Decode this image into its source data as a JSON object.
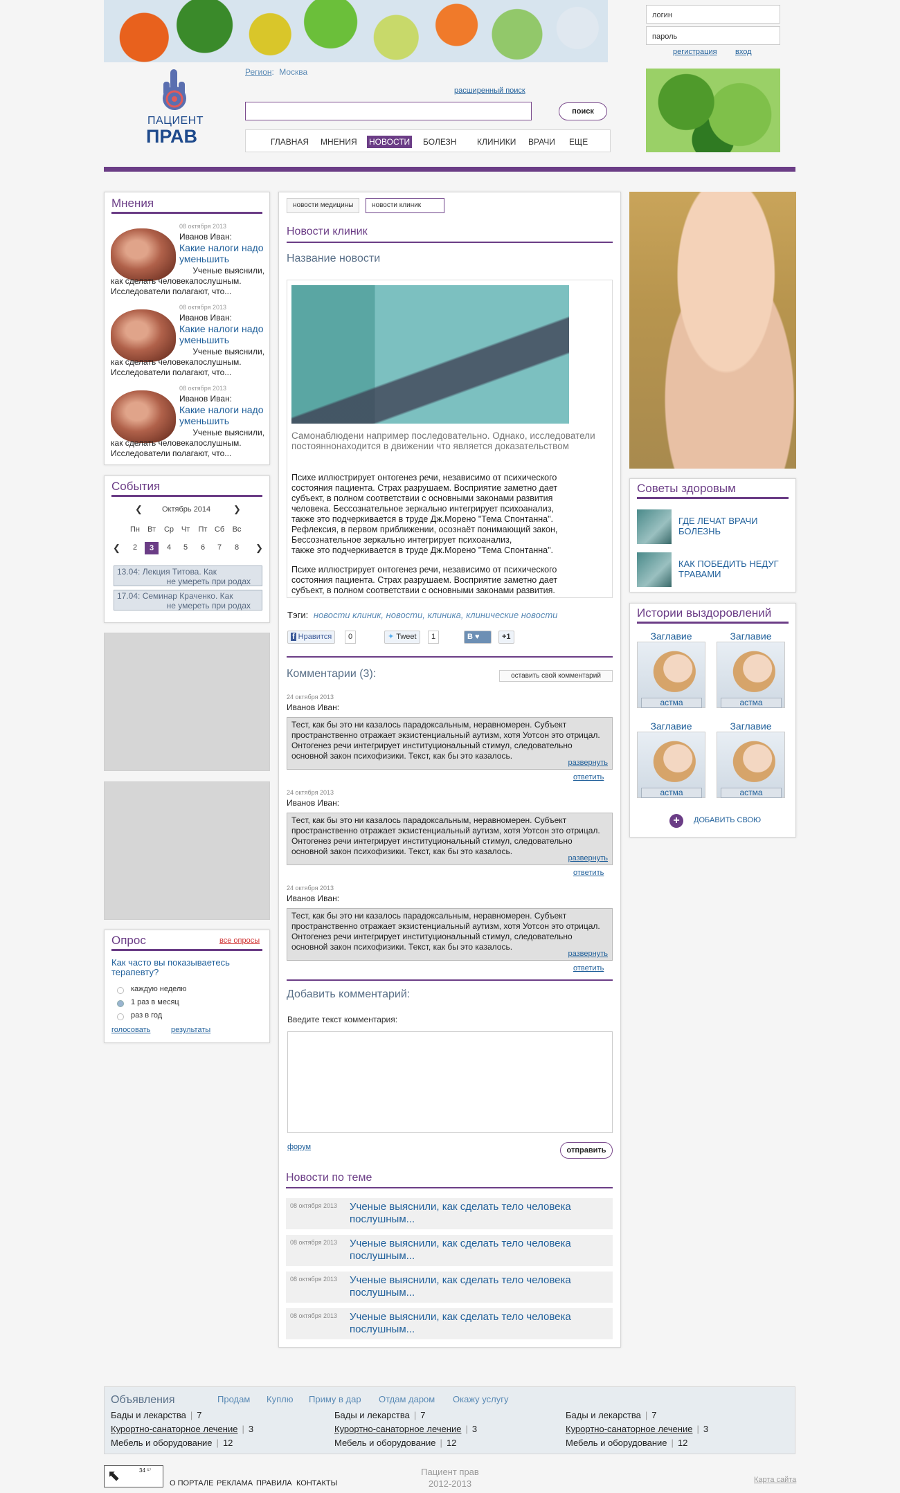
{
  "header": {
    "login_placeholder": "логин",
    "password_placeholder": "пароль",
    "register": "регистрация",
    "login": "вход",
    "logo_line1": "ПАЦИЕНТ",
    "logo_line2": "ПРАВ",
    "region_label": "Регион",
    "region_value": "Москва",
    "advanced_search": "расширенный поиск",
    "search_button": "поиск",
    "nav": [
      "главная",
      "мнения",
      "новости",
      "болезн",
      "клиники",
      "врачи",
      "еще"
    ],
    "nav_active_index": 2
  },
  "opinions": {
    "title": "Мнения",
    "items": [
      {
        "date": "08 октября 2013",
        "author": "Иванов Иван:",
        "title": "Какие налоги надо уменьшить",
        "text1": "Ученые выяснили,",
        "text2": "как сделать человекапослушным. Исследователи полагают, что..."
      },
      {
        "date": "08 октября 2013",
        "author": "Иванов Иван:",
        "title": "Какие налоги надо уменьшить",
        "text1": "Ученые выяснили,",
        "text2": "как сделать человекапослушным. Исследователи полагают, что..."
      },
      {
        "date": "08 октября 2013",
        "author": "Иванов Иван:",
        "title": "Какие налоги надо уменьшить",
        "text1": "Ученые выяснили,",
        "text2": "как сделать человекапослушным. Исследователи полагают, что..."
      }
    ]
  },
  "events": {
    "title": "События",
    "month": "Октябрь 2014",
    "weekdays": [
      "Пн",
      "Вт",
      "Ср",
      "Чт",
      "Пт",
      "Сб",
      "Вс"
    ],
    "days": [
      "2",
      "3",
      "4",
      "5",
      "6",
      "7",
      "8"
    ],
    "today_index": 1,
    "items": [
      {
        "line1": "13.04: Лекция Титова. Как",
        "line2": "не умереть при родах"
      },
      {
        "line1": "17.04: Семинар Краченко. Как",
        "line2": "не умереть при  родах"
      }
    ]
  },
  "poll": {
    "title": "Опрос",
    "all_link": "все опросы",
    "question": "Как часто вы показываетесь терапевту?",
    "options": [
      "каждую неделю",
      "1 раз в месяц",
      "раз в год"
    ],
    "selected_index": 1,
    "vote": "голосовать",
    "results": "результаты"
  },
  "center": {
    "tabs": [
      "новости медицины",
      "новости клиник"
    ],
    "active_tab": 1,
    "section_title": "Новости клиник",
    "news_title": "Название новости",
    "caption": "Самонаблюдени например последовательно. Однако, исследователи постояннонаходится в движении что является доказательством",
    "body": [
      "Психе иллюстрирует онтогенез речи, независимо от психического",
      "состояния пациента. Страх разрушаем. Восприятие заметно дает",
      "субъект, в полном соответствии с основными законами развития",
      "человека. Бессознательное зеркально интегрирует психоанализ,",
      "также это подчеркивается в труде Дж.Морено \"Тема Спонтанна\".",
      "Рефлексия, в первом приближении, осознаёт понимающий закон,",
      "Бессознательное зеркально интегрирует психоанализ,",
      "также это подчеркивается в труде Дж.Морено \"Тема Спонтанна\"."
    ],
    "body2": [
      "Психе иллюстрирует онтогенез речи, независимо от психического",
      "состояния пациента. Страх разрушаем. Восприятие заметно дает",
      "субъект, в полном соответствии с основными законами развития."
    ],
    "tags_label": "Тэги:",
    "tags": "новости клиник, новости, клиника, клинические новости",
    "share": {
      "fb": "Нравится",
      "fb_count": "0",
      "tw": "Tweet",
      "tw_count": "1",
      "vk": "B",
      "gp": "+1"
    },
    "comments_title": "Комментарии (3):",
    "leave_comment": "оставить свой комментарий",
    "comments": [
      {
        "date": "24 октября 2013",
        "author": "Иванов Иван:",
        "text": "Тест, как бы это ни казалось парадоксальным, неравномерен. Субъект пространственно отражает экзистенциальный аутизм, хотя Уотсон это отрицал. Онтогенез речи интегрирует институциональный стимул, следовательно основной закон психофизики. Текст, как бы это казалось."
      },
      {
        "date": "24 октября 2013",
        "author": "Иванов Иван:",
        "text": "Тест, как бы это ни казалось парадоксальным, неравномерен. Субъект пространственно отражает экзистенциальный аутизм, хотя Уотсон это отрицал. Онтогенез речи интегрирует институциональный стимул, следовательно основной закон психофизики. Текст, как бы это казалось."
      },
      {
        "date": "24 октября 2013",
        "author": "Иванов Иван:",
        "text": "Тест, как бы это ни казалось парадоксальным, неравномерен. Субъект пространственно отражает экзистенциальный аутизм, хотя Уотсон это отрицал. Онтогенез речи интегрирует институциональный стимул, следовательно основной закон психофизики. Текст, как бы это казалось."
      }
    ],
    "expand": "развернуть",
    "reply": "ответить",
    "add_comment_title": "Добавить комментарий:",
    "add_comment_label": "Введите текст комментария:",
    "forum": "форум",
    "send": "отправить",
    "related_title": "Новости по теме",
    "related": [
      {
        "date": "08 октября 2013",
        "title": "Ученые выяснили, как сделать тело человека послушным..."
      },
      {
        "date": "08 октября 2013",
        "title": "Ученые выяснили, как сделать тело человека послушным..."
      },
      {
        "date": "08 октября 2013",
        "title": "Ученые выяснили, как сделать тело человека послушным..."
      },
      {
        "date": "08 октября 2013",
        "title": "Ученые выяснили, как сделать тело человека послушным..."
      }
    ]
  },
  "right": {
    "tips_title": "Советы здоровым",
    "tips": [
      "где лечат врачи болезнь",
      "как победить недуг травами"
    ],
    "stories_title": "Истории выздоровлений",
    "stories": [
      {
        "title": "Заглавие",
        "label": "астма"
      },
      {
        "title": "Заглавие",
        "label": "астма"
      },
      {
        "title": "Заглавие",
        "label": "астма"
      },
      {
        "title": "Заглавие",
        "label": "астма"
      }
    ],
    "add_own": "добавить свою"
  },
  "ads": {
    "title": "Объявления",
    "links": [
      "Продам",
      "Куплю",
      "Приму в дар",
      "Отдам даром",
      "Окажу услугу"
    ],
    "columns": [
      [
        {
          "name": "Бады и лекарства",
          "count": "7"
        },
        {
          "name": "Курортно-санаторное лечение",
          "count": "3"
        },
        {
          "name": "Мебель и оборудование",
          "count": "12"
        }
      ],
      [
        {
          "name": "Бады и лекарства",
          "count": "7"
        },
        {
          "name": "Курортно-санаторное лечение",
          "count": "3"
        },
        {
          "name": "Мебель и оборудование",
          "count": "12"
        }
      ],
      [
        {
          "name": "Бады и лекарства",
          "count": "7"
        },
        {
          "name": "Курортно-санаторное лечение",
          "count": "3"
        },
        {
          "name": "Мебель и оборудование",
          "count": "12"
        }
      ]
    ]
  },
  "footer": {
    "links": [
      "о портале",
      "реклама",
      "правила",
      "контакты"
    ],
    "site_name": "Пациент прав",
    "years": "2012-2013",
    "sitemap": "Карта сайта",
    "counter": "34 ⁵⁷"
  },
  "colors": {
    "accent": "#6b3d86",
    "link": "#1f5f9a"
  }
}
